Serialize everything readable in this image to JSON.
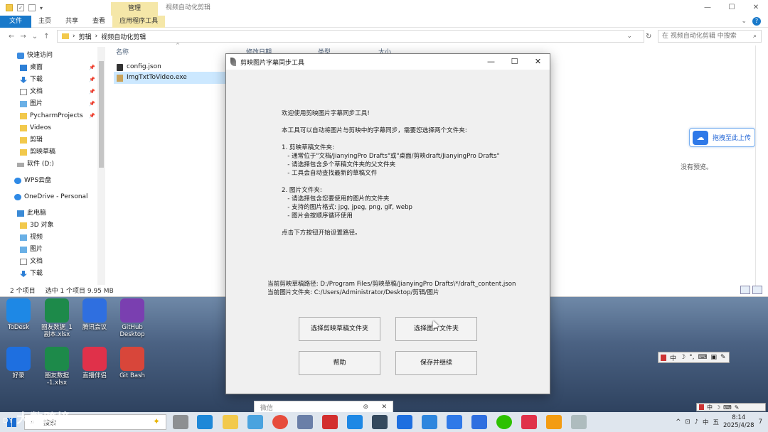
{
  "explorer": {
    "window_title": "视频自动化剪辑",
    "manage_tab": "管理",
    "ribbon_tabs": [
      "文件",
      "主页",
      "共享",
      "查看",
      "应用程序工具"
    ],
    "address": {
      "seg1": "剪辑",
      "seg2": "视频自动化剪辑"
    },
    "search_placeholder": "在 视频自动化剪辑 中搜索",
    "nav": [
      {
        "label": "快速访问",
        "icon": "star-icon"
      },
      {
        "label": "桌面",
        "icon": "desktop-icon",
        "pinned": true
      },
      {
        "label": "下载",
        "icon": "download-icon",
        "pinned": true
      },
      {
        "label": "文档",
        "icon": "document-icon",
        "pinned": true
      },
      {
        "label": "图片",
        "icon": "picture-icon",
        "pinned": true
      },
      {
        "label": "PycharmProjects",
        "icon": "folder-icon",
        "pinned": true
      },
      {
        "label": "Videos",
        "icon": "folder-icon"
      },
      {
        "label": "剪辑",
        "icon": "folder-icon"
      },
      {
        "label": "剪映草稿",
        "icon": "folder-icon"
      },
      {
        "label": "软件 (D:)",
        "icon": "drive-icon"
      },
      {
        "label": "WPS云盘",
        "icon": "cloud-icon"
      },
      {
        "label": "OneDrive - Personal",
        "icon": "cloud-icon"
      },
      {
        "label": "此电脑",
        "icon": "computer-icon"
      },
      {
        "label": "3D 对象",
        "icon": "folder-icon"
      },
      {
        "label": "视频",
        "icon": "video-icon"
      },
      {
        "label": "图片",
        "icon": "picture-icon"
      },
      {
        "label": "文档",
        "icon": "document-icon"
      },
      {
        "label": "下载",
        "icon": "download-icon"
      }
    ],
    "columns": {
      "name": "名称",
      "modified": "修改日期",
      "type": "类型",
      "size": "大小"
    },
    "files": [
      {
        "name": "config.json",
        "icon": "json-file-icon"
      },
      {
        "name": "ImgTxtToVideo.exe",
        "icon": "exe-file-icon"
      }
    ],
    "status": {
      "count": "2 个项目",
      "selected": "选中 1 个项目 9.95 MB"
    },
    "no_preview": "没有预览。",
    "upload_label": "拖拽至此上传"
  },
  "dialog": {
    "title": "剪映图片字幕同步工具",
    "intro_lines": [
      "欢迎使用剪映图片字幕同步工具!",
      "",
      "本工具可以自动将图片与剪映中的字幕同步，需要您选择两个文件夹:",
      "",
      "1. 剪映草稿文件夹:",
      "   - 通常位于\"文档/JianyingPro Drafts\"或\"桌面/剪映draft/JianyingPro Drafts\"",
      "   - 请选择包含多个草稿文件夹的父文件夹",
      "   - 工具会自动查找最新的草稿文件",
      "",
      "2. 图片文件夹:",
      "   - 请选择包含您要使用的图片的文件夹",
      "   - 支持的图片格式: jpg, jpeg, png, gif, webp",
      "   - 图片会按顺序循环使用",
      "",
      "点击下方按钮开始设置路径。"
    ],
    "draft_path": "当前剪映草稿路径: D:/Program Files/剪映草稿/JianyingPro Drafts\\*/draft_content.json",
    "image_path": "当前图片文件夹: C:/Users/Administrator/Desktop/剪辑/图片",
    "buttons": {
      "select_draft": "选择剪映草稿文件夹",
      "select_images": "选择图片文件夹",
      "help": "帮助",
      "save_continue": "保存并继续"
    }
  },
  "desktop_icons": [
    {
      "label": "ToDesk",
      "color": "#1e88e5"
    },
    {
      "label": "圈友数据_1\n副本.xlsx",
      "color": "#1d8a4a"
    },
    {
      "label": "腾讯会议",
      "color": "#2f6fe0"
    },
    {
      "label": "GitHub\nDesktop",
      "color": "#7a3fb0"
    },
    {
      "label": "好录",
      "color": "#1e6fe0"
    },
    {
      "label": "圈友数据\n-1.xlsx",
      "color": "#1d8a4a"
    },
    {
      "label": "直播伴侣",
      "color": "#e0314a"
    },
    {
      "label": "Git Bash",
      "color": "#d8463a"
    }
  ],
  "ime": {
    "mode": "中"
  },
  "chat_popup": {
    "text": "微信"
  },
  "taskbar": {
    "search_text": "搜索",
    "time": "8:14",
    "date": "2025/4/28",
    "lang": "中",
    "ime": "五",
    "notifications": "7"
  },
  "watermark": {
    "small": "DY",
    "text": "大数跨境"
  }
}
